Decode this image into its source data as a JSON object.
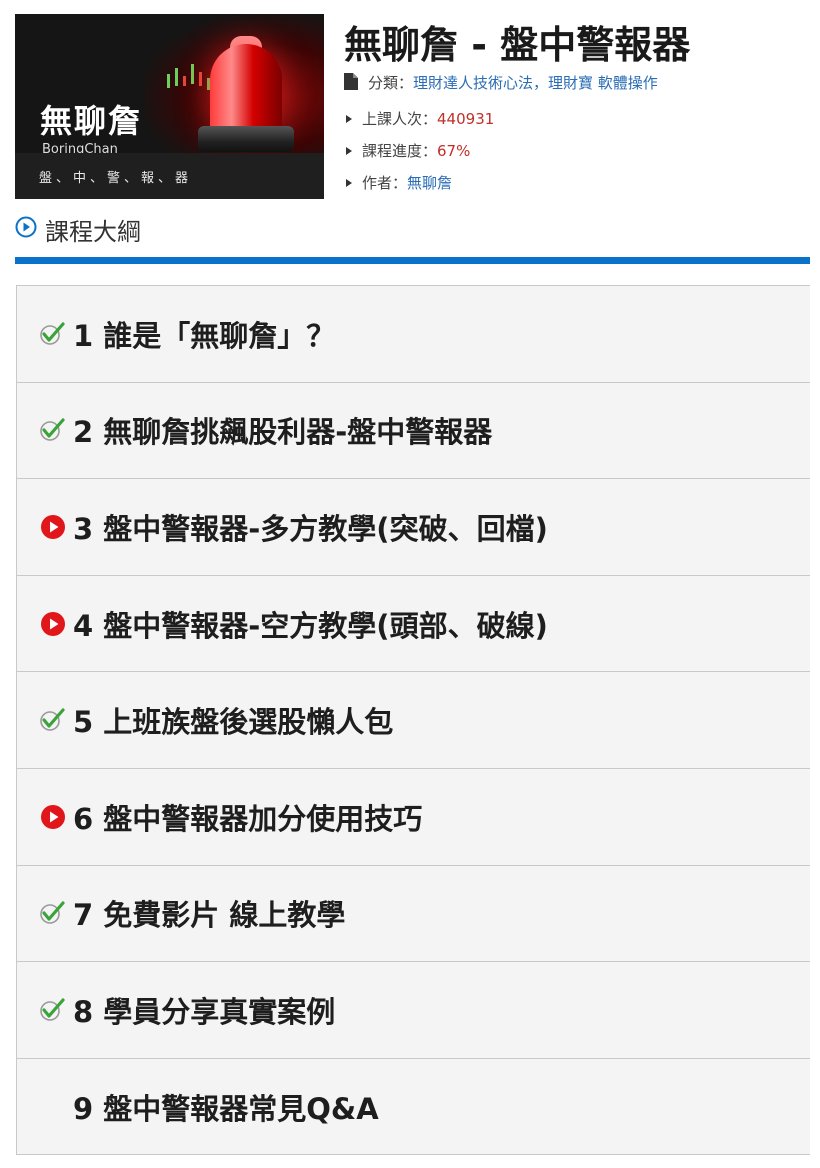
{
  "banner": {
    "title": "無聊詹",
    "subtitle": "BoringChan",
    "tagline": "盤、中、警、報、器"
  },
  "course": {
    "title": "無聊詹 - 盤中警報器",
    "category_label": "分類：",
    "category_value": "理財達人技術心法，理財寶 軟體操作",
    "students_label": "上課人次：",
    "students_value": "440931",
    "progress_label": "課程進度：",
    "progress_value": "67%",
    "author_label": "作者：",
    "author_value": "無聊詹"
  },
  "outline": {
    "heading": "課程大綱",
    "items": [
      {
        "label": "1 誰是「無聊詹」？",
        "status": "completed"
      },
      {
        "label": "2 無聊詹挑飆股利器-盤中警報器",
        "status": "completed"
      },
      {
        "label": "3 盤中警報器-多方教學(突破、回檔)",
        "status": "playable"
      },
      {
        "label": "4 盤中警報器-空方教學(頭部、破線)",
        "status": "playable"
      },
      {
        "label": "5 上班族盤後選股懶人包",
        "status": "completed"
      },
      {
        "label": "6 盤中警報器加分使用技巧",
        "status": "playable"
      },
      {
        "label": "7 免費影片 線上教學",
        "status": "completed"
      },
      {
        "label": "8 學員分享真實案例",
        "status": "completed"
      },
      {
        "label": "9 盤中警報器常見Q&A",
        "status": "none"
      }
    ]
  },
  "colors": {
    "accent_blue": "#0a72c9",
    "play_red": "#e0161b",
    "check_green": "#3aa33a"
  },
  "icons": {
    "completed": "check-icon",
    "playable": "play-icon",
    "outline": "circle-play-icon",
    "category": "document-icon"
  }
}
